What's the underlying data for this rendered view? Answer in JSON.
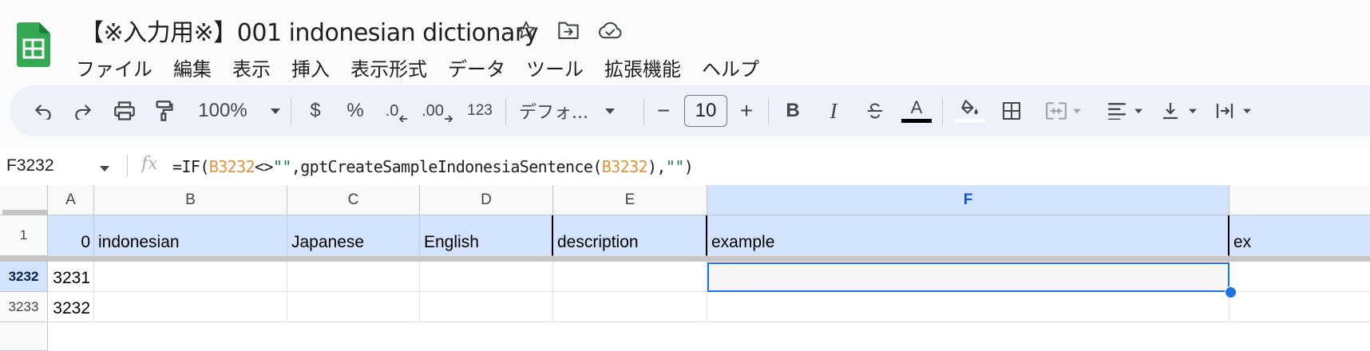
{
  "app": {
    "doc_title": "【※入力用※】001 indonesian dictionary",
    "menu": [
      "ファイル",
      "編集",
      "表示",
      "挿入",
      "表示形式",
      "データ",
      "ツール",
      "拡張機能",
      "ヘルプ"
    ]
  },
  "toolbar": {
    "zoom": "100%",
    "currency": "$",
    "percent": "%",
    "decrease_decimal": ".0",
    "increase_decimal": ".00",
    "number_format": "123",
    "font_family": "デフォ...",
    "minus": "−",
    "font_size": "10",
    "plus": "+",
    "bold": "B",
    "italic": "I",
    "text_color_glyph": "A",
    "accent_color": "#1a73e8"
  },
  "formula_bar": {
    "cell_ref": "F3232",
    "fx": "fx",
    "formula_parts": [
      "=IF(",
      "B3232",
      "<>",
      "\"\"",
      ",gptCreateSampleIndonesiaSentence(",
      "B3232",
      "),",
      "\"\"",
      ")"
    ]
  },
  "grid": {
    "columns": [
      "A",
      "B",
      "C",
      "D",
      "E",
      "F"
    ],
    "selected_column": "F",
    "header_row": {
      "row_number": "1",
      "cells": [
        "0",
        "indonesian",
        "Japanese",
        "English",
        "description",
        "example",
        "ex"
      ]
    },
    "rows": [
      {
        "row_number": "3232",
        "a": "3231",
        "selected": true
      },
      {
        "row_number": "3233",
        "a": "3232",
        "selected": false
      }
    ]
  }
}
